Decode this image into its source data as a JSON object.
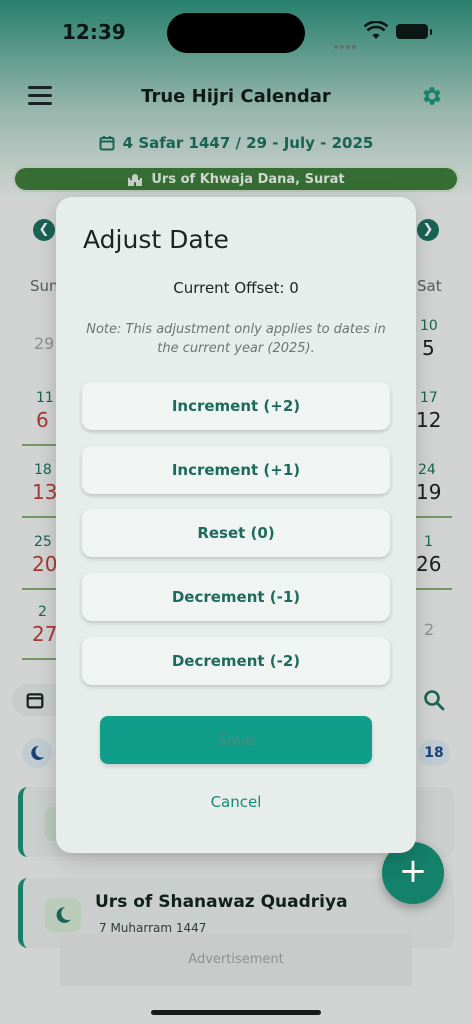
{
  "status_bar": {
    "time": "12:39"
  },
  "header": {
    "title": "True Hijri Calendar",
    "date_line": "4 Safar 1447 / 29 - July - 2025"
  },
  "event_banner": {
    "text": "Urs of Khwaja Dana, Surat"
  },
  "calendar": {
    "weekdays": {
      "first": "Sun",
      "last": "Sat"
    },
    "left_cells": [
      {
        "hijri": "",
        "greg": "29"
      },
      {
        "hijri": "11",
        "greg": "6"
      },
      {
        "hijri": "18",
        "greg": "13"
      },
      {
        "hijri": "25",
        "greg": "20"
      },
      {
        "hijri": "2",
        "greg": "27"
      }
    ],
    "right_cells": [
      {
        "hijri": "10",
        "greg": "5"
      },
      {
        "hijri": "17",
        "greg": "12"
      },
      {
        "hijri": "24",
        "greg": "19"
      },
      {
        "hijri": "1",
        "greg": "26"
      },
      {
        "hijri": "",
        "greg": "2"
      }
    ]
  },
  "events_count": "18",
  "event_card": {
    "title": "Urs of Shanawaz Quadriya",
    "subtitle": "7 Muharram 1447"
  },
  "fab": {
    "label": "+"
  },
  "advertisement": "Advertisement",
  "dialog": {
    "title": "Adjust Date",
    "current_offset": "Current Offset: 0",
    "note": "Note: This adjustment only applies to dates in the current year (2025).",
    "options": [
      "Increment (+2)",
      "Increment (+1)",
      "Reset (0)",
      "Decrement (-1)",
      "Decrement (-2)"
    ],
    "save_label": "Save",
    "cancel_label": "Cancel"
  },
  "colors": {
    "accent": "#0e9e8a",
    "primary": "#1e6f5e",
    "banner": "#3d7a3a",
    "holiday": "#b5413b"
  }
}
